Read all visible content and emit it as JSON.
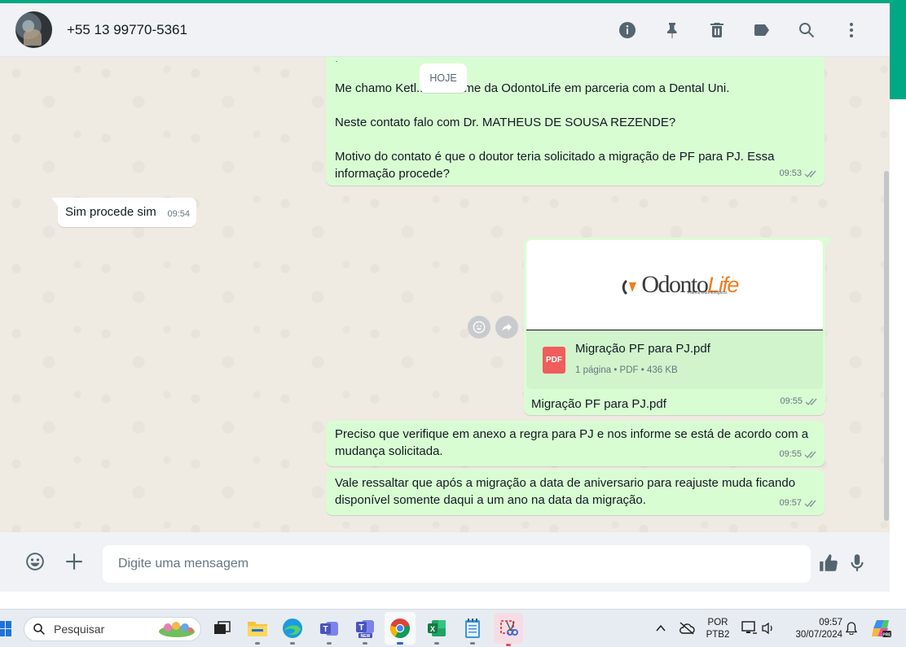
{
  "header": {
    "contact_name": "+55 13 99770-5361",
    "icons": [
      "info-icon",
      "pin-icon",
      "delete-icon",
      "label-icon",
      "search-icon",
      "menu-icon"
    ]
  },
  "chat": {
    "date_chip": "HOJE",
    "messages": [
      {
        "direction": "out",
        "lines": [
          "Me chamo Ketl... em nome da OdontoLife em parceria com a Dental Uni.",
          "Neste contato falo com Dr. MATHEUS DE SOUSA REZENDE?",
          "Motivo do contato é que o doutor teria solicitado a migração de PF para PJ. Essa informação procede?"
        ],
        "time": "09:53"
      },
      {
        "direction": "in",
        "text": "Sim procede sim",
        "time": "09:54"
      },
      {
        "direction": "out",
        "type": "document",
        "preview_logo_main": "Odonto",
        "preview_logo_accent": "Life",
        "preview_logo_sub": "Planos Odontológicos",
        "file_name": "Migração PF para PJ.pdf",
        "file_icon_label": "PDF",
        "file_meta": "1 página • PDF • 436 KB",
        "caption": "Migração PF para PJ.pdf",
        "time": "09:55"
      },
      {
        "direction": "out",
        "text": "Preciso que verifique em anexo a regra para PJ e nos informe se está de acordo com a mudança solicitada.",
        "time": "09:55"
      },
      {
        "direction": "out",
        "text": "Vale ressaltar que após a migração a data de aniversario para reajuste muda ficando disponível somente daqui a um ano na data da migração.",
        "time": "09:57"
      }
    ]
  },
  "composer": {
    "placeholder": "Digite uma mensagem"
  },
  "taskbar": {
    "search_label": "Pesquisar",
    "apps": [
      "file-explorer",
      "edge",
      "teams",
      "teams-new",
      "chrome",
      "excel",
      "notepad",
      "snipping-tool"
    ],
    "language_top": "POR",
    "language_bottom": "PTB2",
    "time": "09:57",
    "date": "30/07/2024"
  },
  "colors": {
    "accent": "#00a884",
    "outgoing_bubble": "#d9fdd3",
    "incoming_bubble": "#ffffff",
    "chat_bg": "#efeae2",
    "pdf_red": "#f15c5c"
  }
}
